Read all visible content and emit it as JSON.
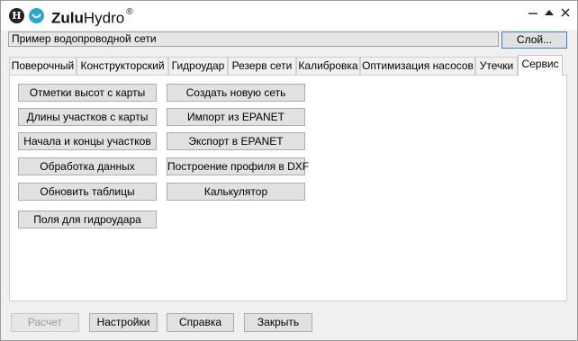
{
  "app": {
    "brand_bold": "Zulu",
    "brand_rest": "Hydro",
    "brand_mark": "®",
    "logo_letter": "H"
  },
  "project": {
    "name": "Пример водопроводной сети",
    "layer_button": "Слой..."
  },
  "tabs": [
    {
      "label": "Поверочный"
    },
    {
      "label": "Конструкторский"
    },
    {
      "label": "Гидроудар"
    },
    {
      "label": "Резерв сети"
    },
    {
      "label": "Калибровка"
    },
    {
      "label": "Оптимизация насосов"
    },
    {
      "label": "Утечки"
    },
    {
      "label": "Сервис",
      "active": true
    }
  ],
  "service": {
    "left_buttons": [
      {
        "label": "Отметки высот с карты"
      },
      {
        "label": "Длины участков с карты"
      },
      {
        "label": "Начала и концы участков"
      },
      {
        "label": "Обработка данных"
      },
      {
        "label": "Обновить таблицы"
      },
      {
        "label": "Поля для гидроудара"
      }
    ],
    "right_buttons": [
      {
        "label": "Создать новую сеть"
      },
      {
        "label": "Импорт из EPANET"
      },
      {
        "label": "Экспорт в EPANET"
      },
      {
        "label": "Построение профиля в DXF"
      },
      {
        "label": "Калькулятор"
      }
    ]
  },
  "footer": {
    "calc": "Расчет",
    "settings": "Настройки",
    "help": "Справка",
    "close": "Закрыть"
  },
  "icons": {
    "minimize": "minimize-icon",
    "maximize": "maximize-icon",
    "close": "close-icon"
  },
  "colors": {
    "accent_border": "#3c7fd1",
    "logo_teal": "#2aa9c9"
  }
}
